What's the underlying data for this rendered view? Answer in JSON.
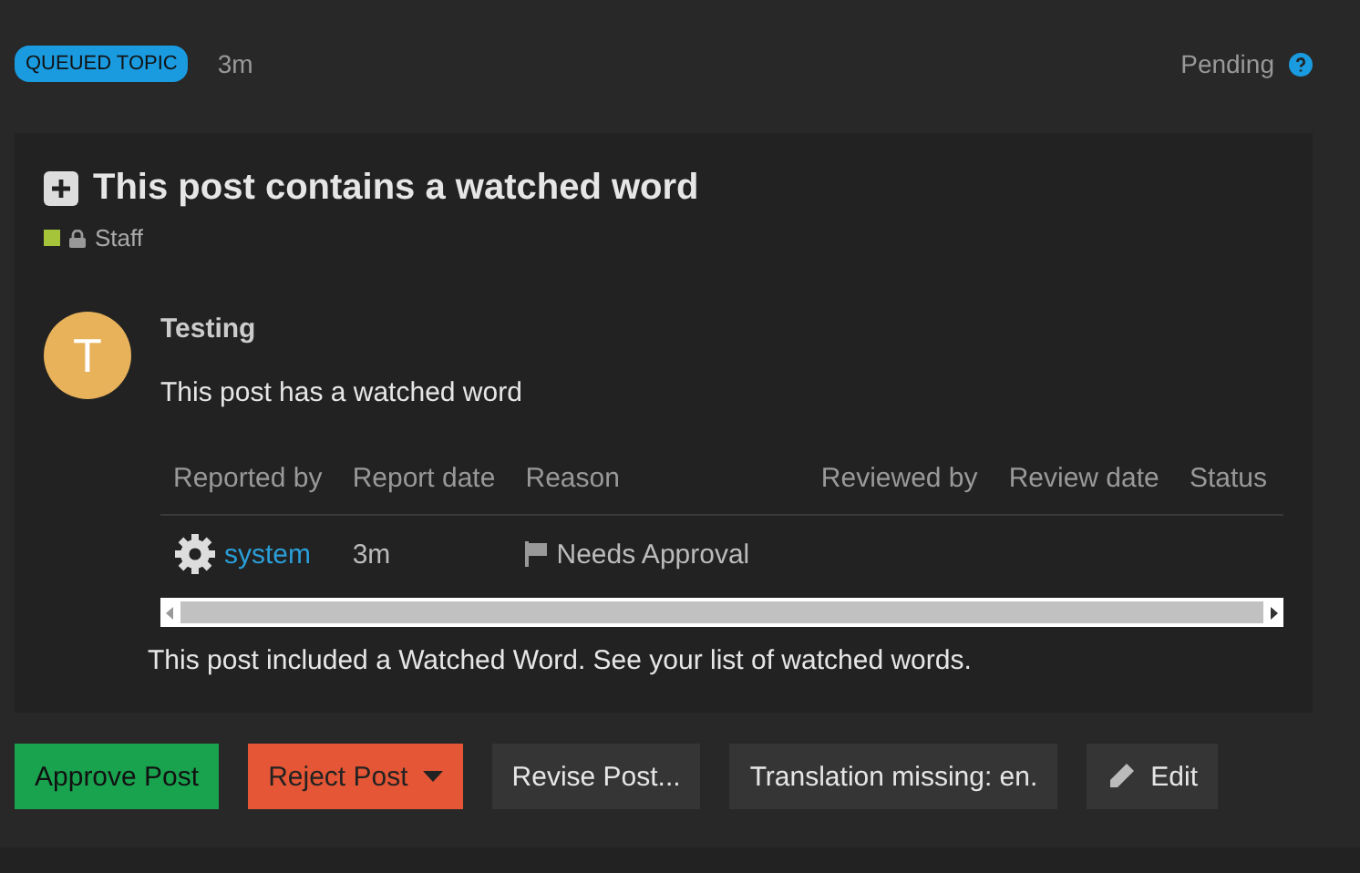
{
  "header": {
    "badge": "QUEUED TOPIC",
    "age": "3m",
    "status": "Pending"
  },
  "topic": {
    "title": "This post contains a watched word",
    "category": {
      "name": "Staff",
      "color": "#a6c43a",
      "locked": true
    }
  },
  "post": {
    "author": "Testing",
    "avatar_letter": "T",
    "body": "This post has a watched word"
  },
  "table": {
    "columns": [
      "Reported by",
      "Report date",
      "Reason",
      "Reviewed by",
      "Review date",
      "Status"
    ],
    "rows": [
      {
        "reporter": "system",
        "date": "3m",
        "reason": "Needs Approval"
      }
    ]
  },
  "note": "This post included a Watched Word. See your list of watched words.",
  "buttons": [
    {
      "label": "Approve Post",
      "kind": "approve"
    },
    {
      "label": "Reject Post",
      "kind": "reject"
    },
    {
      "label": "Revise Post...",
      "kind": "plain"
    },
    {
      "label": "Translation missing: en.",
      "kind": "plain"
    },
    {
      "label": "Edit",
      "kind": "edit"
    }
  ]
}
